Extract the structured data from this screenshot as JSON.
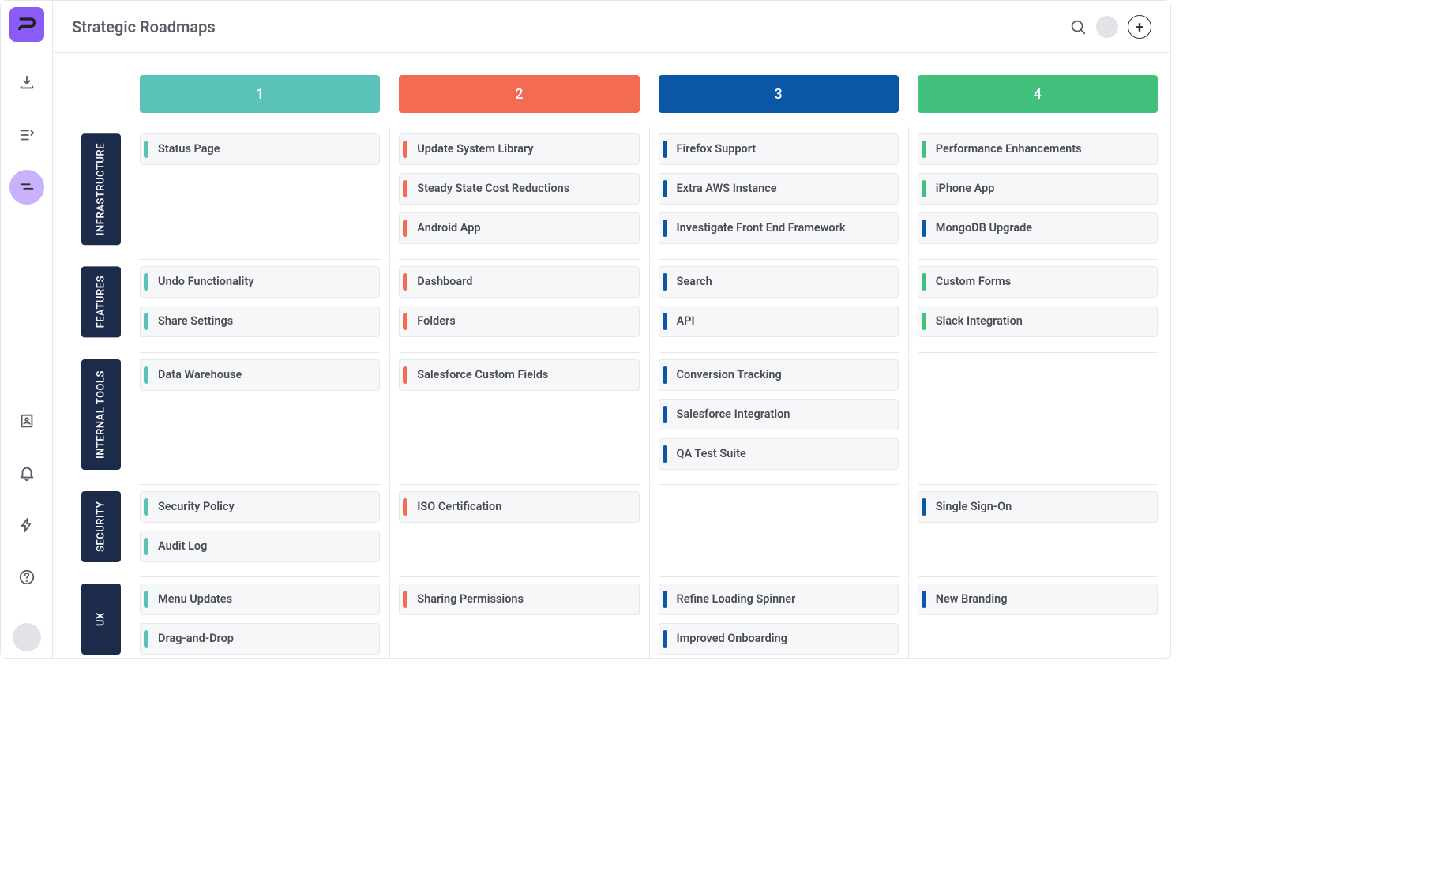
{
  "header": {
    "title": "Strategic Roadmaps"
  },
  "columns": [
    {
      "label": "1",
      "color": "#5bc2b7",
      "tag": "#5bc2b7"
    },
    {
      "label": "2",
      "color": "#f26b52",
      "tag": "#f26b52"
    },
    {
      "label": "3",
      "color": "#0b57a5",
      "tag": "#0b57a5"
    },
    {
      "label": "4",
      "color": "#43c07b",
      "tag": "#43c07b"
    }
  ],
  "rows": [
    {
      "label": "INFRASTRUCTURE",
      "cells": [
        [
          "Status Page"
        ],
        [
          "Update System Library",
          "Steady State Cost Reductions",
          "Android App"
        ],
        [
          "Firefox Support",
          "Extra AWS Instance",
          "Investigate Front End Framework"
        ],
        [
          "Performance Enhancements",
          "iPhone App",
          "MongoDB Upgrade"
        ]
      ],
      "col4tags": [
        "green",
        "green",
        "blue"
      ]
    },
    {
      "label": "FEATURES",
      "cells": [
        [
          "Undo Functionality",
          "Share Settings"
        ],
        [
          "Dashboard",
          "Folders"
        ],
        [
          "Search",
          "API"
        ],
        [
          "Custom Forms",
          "Slack Integration"
        ]
      ],
      "col4tags": [
        "green",
        "green"
      ]
    },
    {
      "label": "INTERNAL TOOLS",
      "cells": [
        [
          "Data Warehouse"
        ],
        [
          "Salesforce Custom Fields"
        ],
        [
          "Conversion Tracking",
          "Salesforce Integration",
          "QA Test Suite"
        ],
        []
      ],
      "col4tags": []
    },
    {
      "label": "SECURITY",
      "cells": [
        [
          "Security Policy",
          "Audit Log"
        ],
        [
          "ISO Certification"
        ],
        [],
        [
          "Single Sign-On"
        ]
      ],
      "col4tags": [
        "blue"
      ]
    },
    {
      "label": "UX",
      "cells": [
        [
          "Menu Updates",
          "Drag-and-Drop"
        ],
        [
          "Sharing Permissions"
        ],
        [
          "Refine Loading Spinner",
          "Improved Onboarding"
        ],
        [
          "New Branding"
        ]
      ],
      "col4tags": [
        "blue"
      ]
    }
  ],
  "tagColors": {
    "green": "#43c07b",
    "blue": "#0b57a5"
  }
}
